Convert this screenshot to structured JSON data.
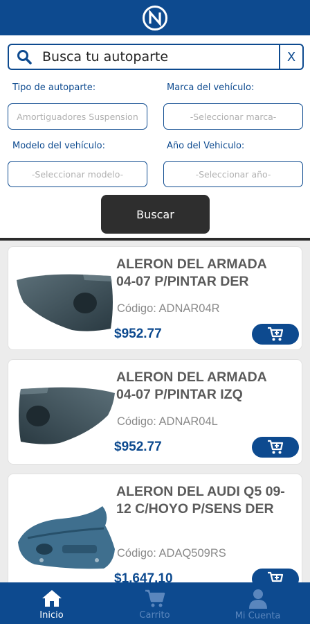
{
  "header": {
    "logo_letter": "N"
  },
  "search": {
    "text": "Busca tu autoparte",
    "clear_label": "X"
  },
  "filters": {
    "part_type_label": "Tipo de autoparte:",
    "part_type_value": "Amortiguadores Suspension",
    "brand_label": "Marca del vehículo:",
    "brand_placeholder": "-Seleccionar marca-",
    "model_label": "Modelo del vehículo:",
    "model_placeholder": "-Seleccionar modelo-",
    "year_label": "Año del Vehiculo:",
    "year_placeholder": "-Seleccionar año-"
  },
  "search_button": "Buscar",
  "products": [
    {
      "title": "ALERON DEL ARMADA 04-07 P/PINTAR DER",
      "code": "Código: ADNAR04R",
      "price": "$952.77"
    },
    {
      "title": "ALERON DEL ARMADA 04-07 P/PINTAR IZQ",
      "code": "Código: ADNAR04L",
      "price": "$952.77"
    },
    {
      "title": "ALERON DEL AUDI Q5 09-12 C/HOYO P/SENS DER",
      "code": "Código: ADAQ509RS",
      "price": "$1,647.10"
    }
  ],
  "nav": {
    "home": "Inicio",
    "cart": "Carrito",
    "account": "Mi Cuenta"
  },
  "colors": {
    "brand": "#0d4a8f",
    "button_dark": "#2e2e2e",
    "inactive_nav": "#5a86bd"
  }
}
